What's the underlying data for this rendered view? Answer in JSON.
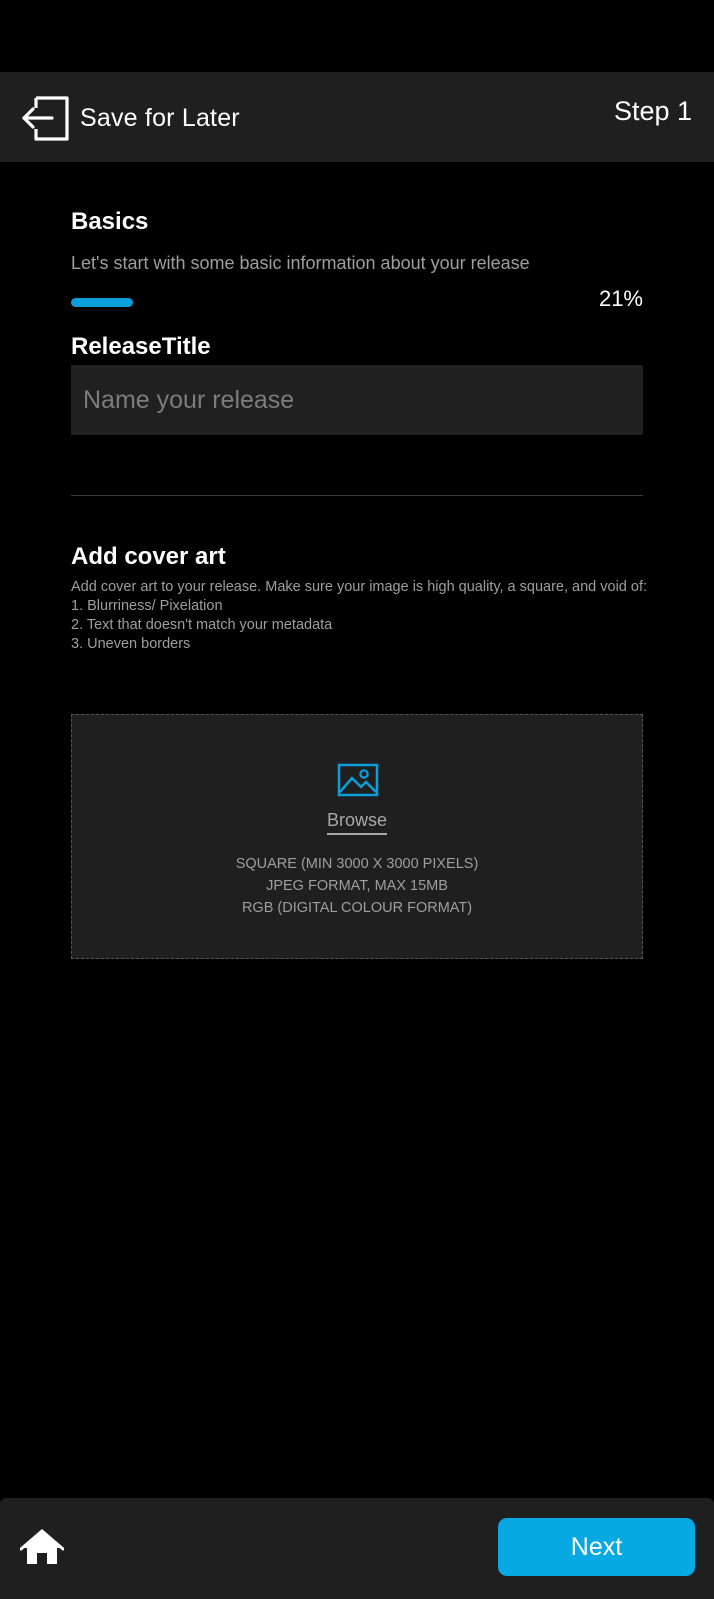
{
  "header": {
    "save_label": "Save for Later",
    "step_label": "Step 1",
    "save_icon": "exit-icon"
  },
  "basics": {
    "title": "Basics",
    "subtitle": "Let's start with some basic information about your release",
    "progress_percent_label": "21%",
    "progress_fraction": 0.21
  },
  "release_title": {
    "label": "ReleaseTitle",
    "placeholder": "Name your release",
    "value": ""
  },
  "cover_art": {
    "title": "Add cover art",
    "description": "Add cover art to your release. Make sure your image is high quality, a square, and void of:",
    "items": [
      "1. Blurriness/ Pixelation",
      "2. Text that doesn't match your metadata",
      "3. Uneven borders"
    ],
    "upload_icon": "image-icon",
    "browse_label": "Browse",
    "requirements": [
      "SQUARE (MIN 3000 X 3000 PIXELS)",
      "JPEG FORMAT, MAX 15MB",
      "RGB (DIGITAL COLOUR FORMAT)"
    ]
  },
  "footer": {
    "home_icon": "home-icon",
    "next_label": "Next"
  },
  "colors": {
    "accent": "#08a8e3",
    "background": "#000000",
    "surface": "#1f1f1f",
    "muted_text": "#9e9e9e"
  }
}
